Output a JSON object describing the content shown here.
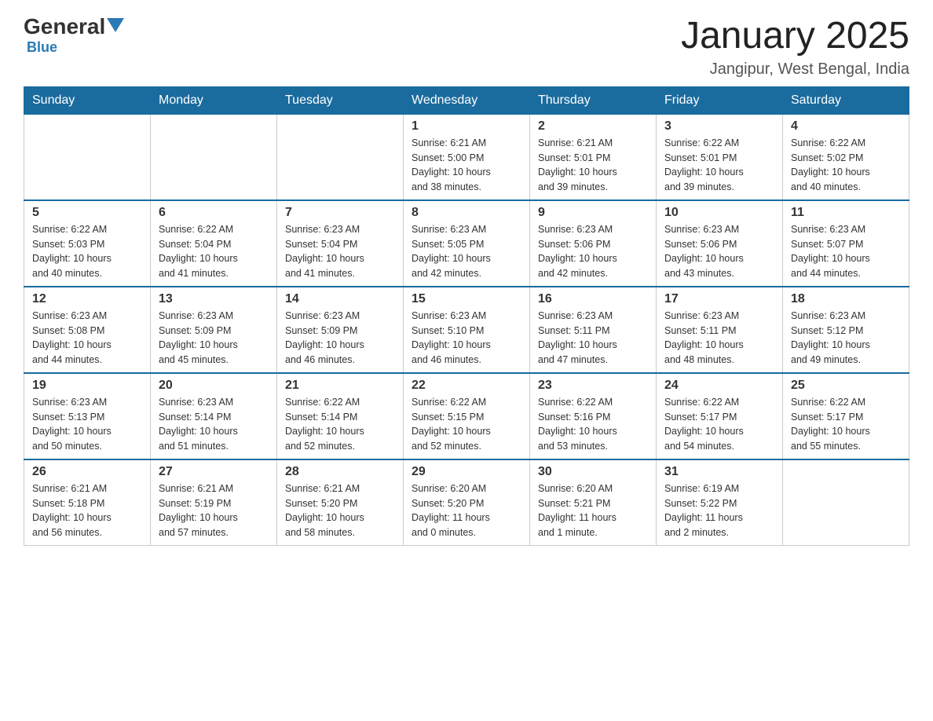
{
  "logo": {
    "general": "General",
    "blue": "Blue",
    "triangle": "▼"
  },
  "title": "January 2025",
  "location": "Jangipur, West Bengal, India",
  "days_of_week": [
    "Sunday",
    "Monday",
    "Tuesday",
    "Wednesday",
    "Thursday",
    "Friday",
    "Saturday"
  ],
  "weeks": [
    [
      {
        "day": "",
        "info": ""
      },
      {
        "day": "",
        "info": ""
      },
      {
        "day": "",
        "info": ""
      },
      {
        "day": "1",
        "info": "Sunrise: 6:21 AM\nSunset: 5:00 PM\nDaylight: 10 hours\nand 38 minutes."
      },
      {
        "day": "2",
        "info": "Sunrise: 6:21 AM\nSunset: 5:01 PM\nDaylight: 10 hours\nand 39 minutes."
      },
      {
        "day": "3",
        "info": "Sunrise: 6:22 AM\nSunset: 5:01 PM\nDaylight: 10 hours\nand 39 minutes."
      },
      {
        "day": "4",
        "info": "Sunrise: 6:22 AM\nSunset: 5:02 PM\nDaylight: 10 hours\nand 40 minutes."
      }
    ],
    [
      {
        "day": "5",
        "info": "Sunrise: 6:22 AM\nSunset: 5:03 PM\nDaylight: 10 hours\nand 40 minutes."
      },
      {
        "day": "6",
        "info": "Sunrise: 6:22 AM\nSunset: 5:04 PM\nDaylight: 10 hours\nand 41 minutes."
      },
      {
        "day": "7",
        "info": "Sunrise: 6:23 AM\nSunset: 5:04 PM\nDaylight: 10 hours\nand 41 minutes."
      },
      {
        "day": "8",
        "info": "Sunrise: 6:23 AM\nSunset: 5:05 PM\nDaylight: 10 hours\nand 42 minutes."
      },
      {
        "day": "9",
        "info": "Sunrise: 6:23 AM\nSunset: 5:06 PM\nDaylight: 10 hours\nand 42 minutes."
      },
      {
        "day": "10",
        "info": "Sunrise: 6:23 AM\nSunset: 5:06 PM\nDaylight: 10 hours\nand 43 minutes."
      },
      {
        "day": "11",
        "info": "Sunrise: 6:23 AM\nSunset: 5:07 PM\nDaylight: 10 hours\nand 44 minutes."
      }
    ],
    [
      {
        "day": "12",
        "info": "Sunrise: 6:23 AM\nSunset: 5:08 PM\nDaylight: 10 hours\nand 44 minutes."
      },
      {
        "day": "13",
        "info": "Sunrise: 6:23 AM\nSunset: 5:09 PM\nDaylight: 10 hours\nand 45 minutes."
      },
      {
        "day": "14",
        "info": "Sunrise: 6:23 AM\nSunset: 5:09 PM\nDaylight: 10 hours\nand 46 minutes."
      },
      {
        "day": "15",
        "info": "Sunrise: 6:23 AM\nSunset: 5:10 PM\nDaylight: 10 hours\nand 46 minutes."
      },
      {
        "day": "16",
        "info": "Sunrise: 6:23 AM\nSunset: 5:11 PM\nDaylight: 10 hours\nand 47 minutes."
      },
      {
        "day": "17",
        "info": "Sunrise: 6:23 AM\nSunset: 5:11 PM\nDaylight: 10 hours\nand 48 minutes."
      },
      {
        "day": "18",
        "info": "Sunrise: 6:23 AM\nSunset: 5:12 PM\nDaylight: 10 hours\nand 49 minutes."
      }
    ],
    [
      {
        "day": "19",
        "info": "Sunrise: 6:23 AM\nSunset: 5:13 PM\nDaylight: 10 hours\nand 50 minutes."
      },
      {
        "day": "20",
        "info": "Sunrise: 6:23 AM\nSunset: 5:14 PM\nDaylight: 10 hours\nand 51 minutes."
      },
      {
        "day": "21",
        "info": "Sunrise: 6:22 AM\nSunset: 5:14 PM\nDaylight: 10 hours\nand 52 minutes."
      },
      {
        "day": "22",
        "info": "Sunrise: 6:22 AM\nSunset: 5:15 PM\nDaylight: 10 hours\nand 52 minutes."
      },
      {
        "day": "23",
        "info": "Sunrise: 6:22 AM\nSunset: 5:16 PM\nDaylight: 10 hours\nand 53 minutes."
      },
      {
        "day": "24",
        "info": "Sunrise: 6:22 AM\nSunset: 5:17 PM\nDaylight: 10 hours\nand 54 minutes."
      },
      {
        "day": "25",
        "info": "Sunrise: 6:22 AM\nSunset: 5:17 PM\nDaylight: 10 hours\nand 55 minutes."
      }
    ],
    [
      {
        "day": "26",
        "info": "Sunrise: 6:21 AM\nSunset: 5:18 PM\nDaylight: 10 hours\nand 56 minutes."
      },
      {
        "day": "27",
        "info": "Sunrise: 6:21 AM\nSunset: 5:19 PM\nDaylight: 10 hours\nand 57 minutes."
      },
      {
        "day": "28",
        "info": "Sunrise: 6:21 AM\nSunset: 5:20 PM\nDaylight: 10 hours\nand 58 minutes."
      },
      {
        "day": "29",
        "info": "Sunrise: 6:20 AM\nSunset: 5:20 PM\nDaylight: 11 hours\nand 0 minutes."
      },
      {
        "day": "30",
        "info": "Sunrise: 6:20 AM\nSunset: 5:21 PM\nDaylight: 11 hours\nand 1 minute."
      },
      {
        "day": "31",
        "info": "Sunrise: 6:19 AM\nSunset: 5:22 PM\nDaylight: 11 hours\nand 2 minutes."
      },
      {
        "day": "",
        "info": ""
      }
    ]
  ]
}
